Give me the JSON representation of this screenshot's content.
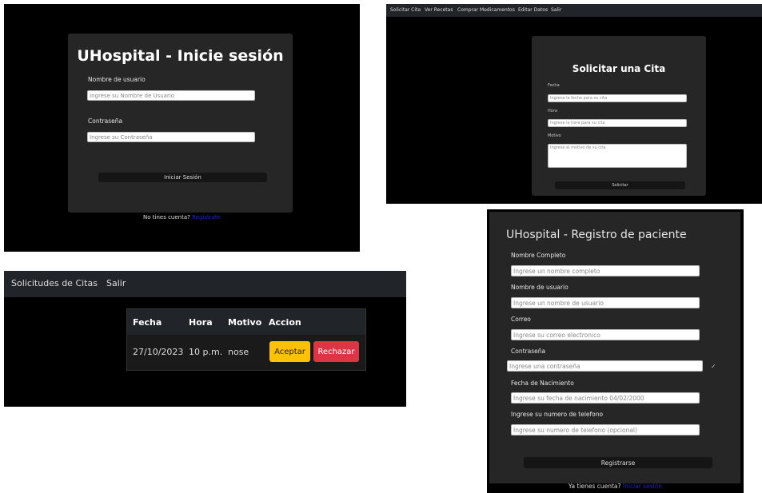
{
  "login": {
    "title": "UHospital - Inicie sesión",
    "username_label": "Nombre de usuario",
    "username_placeholder": "Ingrese su Nombre de Usuario",
    "password_label": "Contraseña",
    "password_placeholder": "Ingrese su Contraseña",
    "submit_label": "Iniciar Sesión",
    "footer_text": "No tines cuenta?",
    "footer_link": "Registrate"
  },
  "cita": {
    "nav": [
      "Solicitar Cita",
      "Ver Recetas",
      "Comprar Medicamentos",
      "Editar Datos",
      "Salir"
    ],
    "title": "Solicitar una Cita",
    "fecha_label": "Fecha",
    "fecha_placeholder": "Ingrese la fecha para su cita",
    "hora_label": "Hora",
    "hora_placeholder": "Ingrese la hora para su cita",
    "motivo_label": "Motivo",
    "motivo_placeholder": "Ingrese el motivo de su cita",
    "submit_label": "Solicitar"
  },
  "solicitudes": {
    "nav": [
      "Solicitudes de Citas",
      "Salir"
    ],
    "columns": [
      "Fecha",
      "Hora",
      "Motivo",
      "Accion"
    ],
    "rows": [
      {
        "fecha": "27/10/2023",
        "hora": "10 p.m.",
        "motivo": "nose"
      }
    ],
    "accept_label": "Aceptar",
    "reject_label": "Rechazar"
  },
  "registro": {
    "title": "UHospital - Registro de paciente",
    "fields": [
      {
        "label": "Nombre Completo",
        "placeholder": "Ingrese un nombre completo"
      },
      {
        "label": "Nombre de usuario",
        "placeholder": "Ingrese un nombre de usuario"
      },
      {
        "label": "Correo",
        "placeholder": "Ingrese su correo electronico"
      },
      {
        "label": "Contraseña",
        "placeholder": "Ingrese una contraseña"
      },
      {
        "label": "Fecha de Nacimiento",
        "placeholder": "Ingrese su fecha de nacimiento 04/02/2000"
      },
      {
        "label": "Ingrese su numero de telefono",
        "placeholder": "Ingrese su numero de telefono (opcional)"
      }
    ],
    "check_icon": "check-icon",
    "submit_label": "Registrarse",
    "footer_text": "Ya tienes cuenta?",
    "footer_link": "Iniciar sesión"
  }
}
